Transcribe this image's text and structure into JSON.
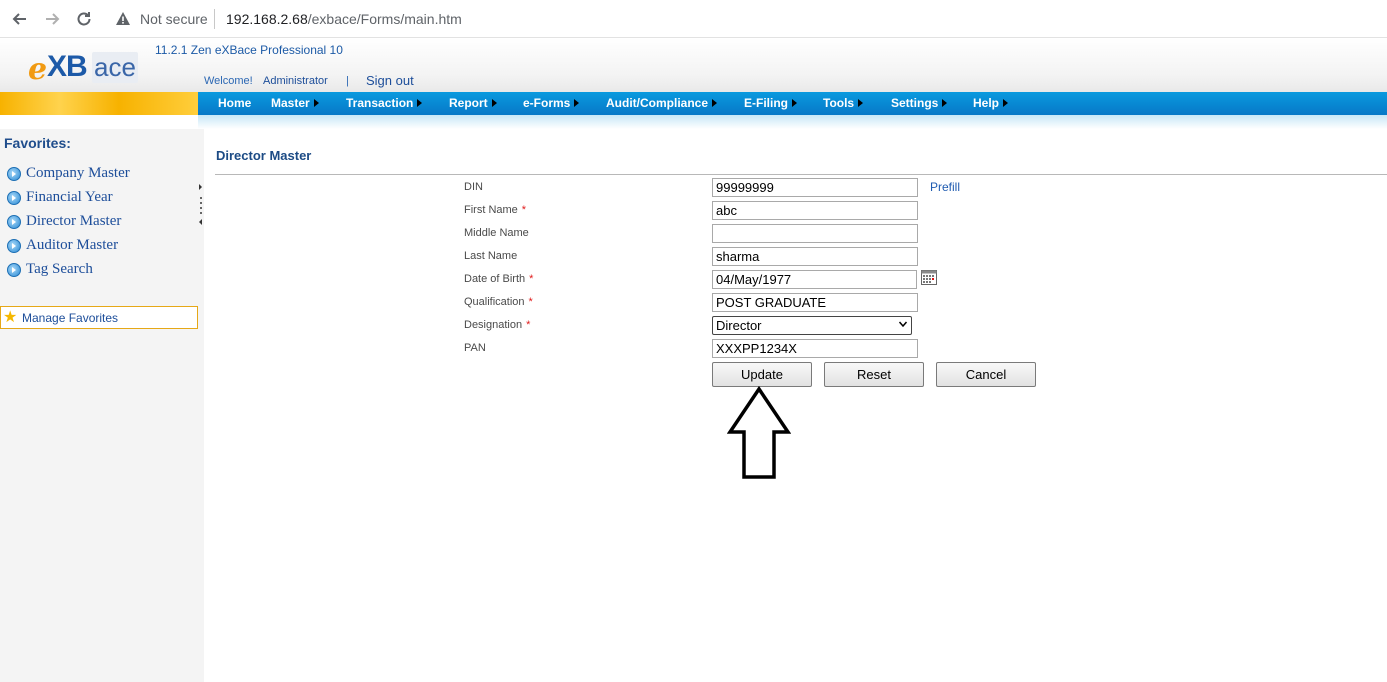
{
  "browser": {
    "not_secure": "Not secure",
    "url_host": "192.168.2.68",
    "url_path": "/exbace/Forms/main.htm"
  },
  "header": {
    "logo": "eXBace",
    "version": "11.2.1 Zen eXBace Professional 10",
    "welcome": "Welcome!",
    "user": "Administrator",
    "separator": "|",
    "sign_out": "Sign out"
  },
  "menu": {
    "items": [
      {
        "label": "Home",
        "has_submenu": false
      },
      {
        "label": "Master",
        "has_submenu": true
      },
      {
        "label": "Transaction",
        "has_submenu": true
      },
      {
        "label": "Report",
        "has_submenu": true
      },
      {
        "label": "e-Forms",
        "has_submenu": true
      },
      {
        "label": "Audit/Compliance",
        "has_submenu": true
      },
      {
        "label": "E-Filing",
        "has_submenu": true
      },
      {
        "label": "Tools",
        "has_submenu": true
      },
      {
        "label": "Settings",
        "has_submenu": true
      },
      {
        "label": "Help",
        "has_submenu": true
      }
    ]
  },
  "sidebar": {
    "title": "Favorites:",
    "items": [
      {
        "label": "Company Master"
      },
      {
        "label": "Financial Year"
      },
      {
        "label": "Director Master"
      },
      {
        "label": "Auditor Master"
      },
      {
        "label": "Tag Search"
      }
    ],
    "manage": "Manage Favorites"
  },
  "form": {
    "title": "Director Master",
    "prefill": "Prefill",
    "fields": [
      {
        "label": "DIN",
        "required": false,
        "value": "99999999"
      },
      {
        "label": "First Name",
        "required": true,
        "value": "abc"
      },
      {
        "label": "Middle Name",
        "required": false,
        "value": ""
      },
      {
        "label": "Last Name",
        "required": false,
        "value": "sharma"
      },
      {
        "label": "Date of Birth",
        "required": true,
        "value": "04/May/1977"
      },
      {
        "label": "Qualification",
        "required": true,
        "value": "POST GRADUATE"
      },
      {
        "label": "Designation",
        "required": true,
        "value": "Director"
      },
      {
        "label": "PAN",
        "required": false,
        "value": "XXXPP1234X"
      }
    ],
    "required_mark": "*",
    "buttons": {
      "update": "Update",
      "reset": "Reset",
      "cancel": "Cancel"
    }
  },
  "colors": {
    "menu_blue": "#0778c7",
    "menu_gold": "#f7b200",
    "link_blue": "#1d4e9a",
    "required_red": "#e01b1b"
  }
}
